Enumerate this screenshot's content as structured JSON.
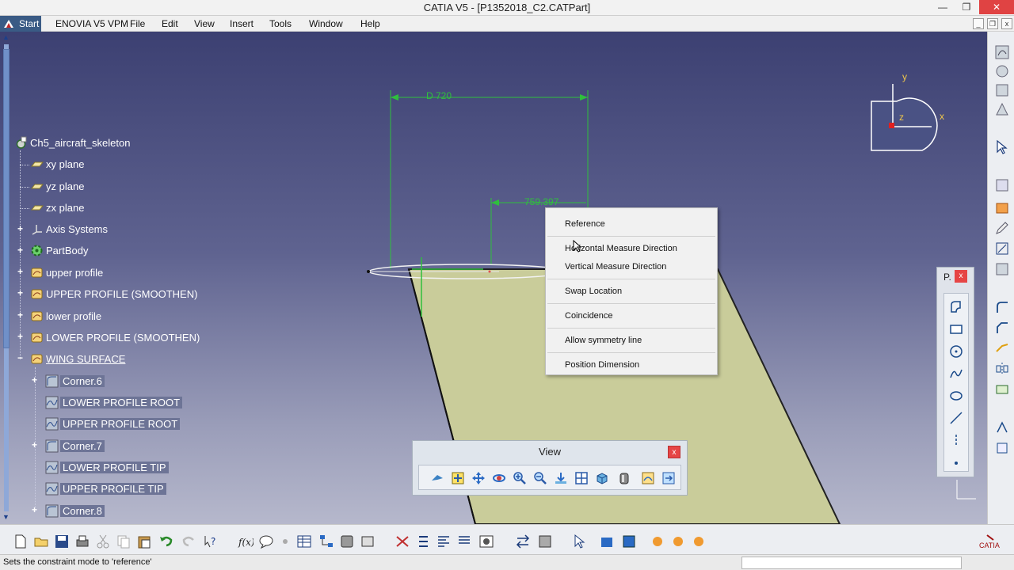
{
  "window": {
    "title": "CATIA V5 - [P1352018_C2.CATPart]",
    "controls": {
      "minimize": "—",
      "maximize": "❐",
      "close": "✕"
    }
  },
  "menubar": {
    "items": [
      "Start",
      "ENOVIA V5 VPM",
      "File",
      "Edit",
      "View",
      "Insert",
      "Tools",
      "Window",
      "Help"
    ]
  },
  "tree": {
    "root": "Ch5_aircraft_skeleton",
    "nodes": [
      {
        "label": "xy plane",
        "icon": "plane-icon"
      },
      {
        "label": "yz plane",
        "icon": "plane-icon"
      },
      {
        "label": "zx plane",
        "icon": "plane-icon"
      },
      {
        "label": "Axis Systems",
        "icon": "axis-system-icon"
      },
      {
        "label": "PartBody",
        "icon": "partbody-gear-icon"
      },
      {
        "label": "upper profile",
        "icon": "geometrical-set-icon"
      },
      {
        "label": "UPPER PROFILE (SMOOTHEN)",
        "icon": "geometrical-set-icon"
      },
      {
        "label": "lower profile",
        "icon": "geometrical-set-icon"
      },
      {
        "label": "LOWER PROFILE (SMOOTHEN)",
        "icon": "geometrical-set-icon"
      },
      {
        "label": "WING SURFACE",
        "icon": "geometrical-set-icon"
      },
      {
        "label": "Corner.6",
        "icon": "corner-icon"
      },
      {
        "label": "LOWER PROFILE ROOT",
        "icon": "spline-icon"
      },
      {
        "label": "UPPER PROFILE ROOT",
        "icon": "spline-icon"
      },
      {
        "label": "Corner.7",
        "icon": "corner-icon"
      },
      {
        "label": "LOWER PROFILE TIP",
        "icon": "spline-icon"
      },
      {
        "label": "UPPER PROFILE TIP",
        "icon": "spline-icon"
      },
      {
        "label": "Corner.8",
        "icon": "corner-icon"
      }
    ]
  },
  "viewport": {
    "dimension_1": "D 720",
    "dimension_2": "759.397",
    "compass": {
      "y": "y",
      "x": "x",
      "z": "z"
    },
    "surface_color": "#c9cc9a",
    "background_top": "#3c4072"
  },
  "context_menu": {
    "items": [
      "Reference",
      "Horizontal Measure Direction",
      "Vertical Measure Direction",
      "Swap Location",
      "Coincidence",
      "Allow symmetry line",
      "Position Dimension"
    ]
  },
  "view_toolbar": {
    "title": "View",
    "close": "x"
  },
  "profile_toolbar": {
    "title": "P.",
    "close": "x"
  },
  "status": {
    "text": "Sets the constraint mode to 'reference'"
  }
}
